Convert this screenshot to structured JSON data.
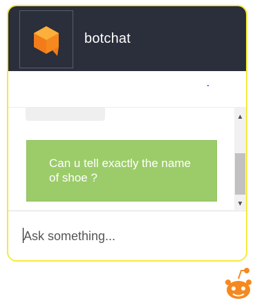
{
  "header": {
    "bot_name": "botchat",
    "avatar_icon": "orange-speech-cube-icon"
  },
  "messages": [
    {
      "from": "user",
      "text": "Can u tell exactly the name of shoe ?"
    }
  ],
  "input": {
    "placeholder": "Ask something...",
    "value": ""
  },
  "scrollbar": {
    "up_arrow": "^",
    "down_arrow": "v"
  },
  "launcher": {
    "icon": "reddit-alien-icon"
  },
  "colors": {
    "header_bg": "#2b2e3b",
    "border": "#f5ea3a",
    "user_bubble": "#9ccc6a",
    "avatar_orange": "#f5891f"
  }
}
